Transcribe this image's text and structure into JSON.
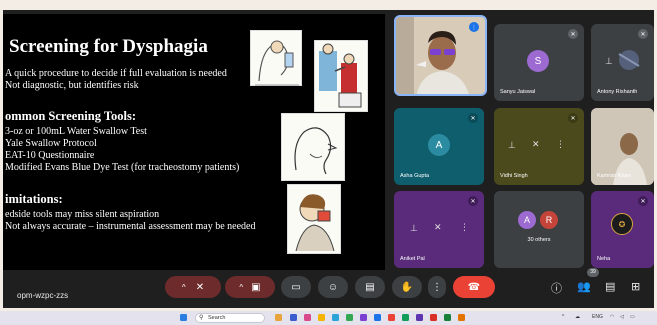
{
  "slide": {
    "title": "Screening for Dysphagia",
    "lines": [
      "A quick procedure to decide if full evaluation is needed",
      "Not diagnostic, but identifies risk"
    ],
    "heading_tools": "ommon Screening Tools:",
    "tools": [
      "3-oz or 100mL Water Swallow Test",
      "Yale Swallow Protocol",
      "EAT-10 Questionnaire",
      "Modified Evans Blue Dye Test (for tracheostomy patients)"
    ],
    "heading_limits": "imitations:",
    "limits": [
      "edside tools may miss silent aspiration",
      "Not always accurate – instrumental assessment may be needed"
    ]
  },
  "participants": {
    "speaker_name": "Sanyu Jaiswal",
    "speaker_initial": "S",
    "antony": "Antony Rishanth",
    "asha": "Asha Gupta",
    "asha_initial": "A",
    "vidhi": "Vidhi Singh",
    "kamran": "Kamran Khan",
    "aniket": "Aniket Pal",
    "others_label": "30 others",
    "others_initials": [
      "A",
      "R"
    ],
    "neha": "Neha"
  },
  "meeting": {
    "code": "opm-wzpc-zzs",
    "people_count": "39"
  },
  "taskbar": {
    "search_label": "Search",
    "lang": "ENG"
  },
  "colors": {
    "end_call": "#ea4335",
    "muted_bg": "#6d2b2b",
    "tile_teal": "#0f5e6e",
    "tile_olive": "#4a4a1d",
    "tile_purple": "#5a2b7a",
    "tile_gray": "#3c4043",
    "avatar_purple": "#9c6ad1",
    "avatar_teal": "#2b8ca1"
  }
}
